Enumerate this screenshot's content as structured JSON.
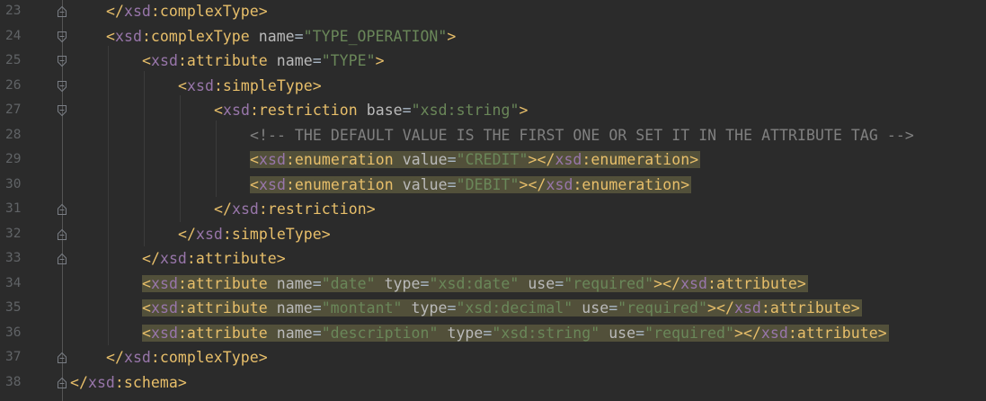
{
  "editor": {
    "lines": [
      {
        "number": "23",
        "fold": "fold-end",
        "segments": [
          {
            "t": "</",
            "c": "bracket"
          },
          {
            "t": "xsd",
            "c": "ns"
          },
          {
            "t": ":complexType",
            "c": "tag"
          },
          {
            "t": ">",
            "c": "bracket"
          }
        ]
      },
      {
        "number": "24",
        "fold": "fold-start",
        "segments": [
          {
            "t": "<",
            "c": "bracket"
          },
          {
            "t": "xsd",
            "c": "ns"
          },
          {
            "t": ":complexType ",
            "c": "tag"
          },
          {
            "t": "name",
            "c": "attr"
          },
          {
            "t": "=",
            "c": "eq"
          },
          {
            "t": "\"TYPE_OPERATION\"",
            "c": "str"
          },
          {
            "t": ">",
            "c": "bracket"
          }
        ]
      },
      {
        "number": "25",
        "fold": "fold-start",
        "segments": [
          {
            "t": "<",
            "c": "bracket"
          },
          {
            "t": "xsd",
            "c": "ns"
          },
          {
            "t": ":attribute ",
            "c": "tag"
          },
          {
            "t": "name",
            "c": "attr"
          },
          {
            "t": "=",
            "c": "eq"
          },
          {
            "t": "\"TYPE\"",
            "c": "str"
          },
          {
            "t": ">",
            "c": "bracket"
          }
        ]
      },
      {
        "number": "26",
        "fold": "fold-start",
        "segments": [
          {
            "t": "<",
            "c": "bracket"
          },
          {
            "t": "xsd",
            "c": "ns"
          },
          {
            "t": ":simpleType",
            "c": "tag"
          },
          {
            "t": ">",
            "c": "bracket"
          }
        ]
      },
      {
        "number": "27",
        "fold": "fold-start",
        "segments": [
          {
            "t": "<",
            "c": "bracket"
          },
          {
            "t": "xsd",
            "c": "ns"
          },
          {
            "t": ":restriction ",
            "c": "tag"
          },
          {
            "t": "base",
            "c": "attr"
          },
          {
            "t": "=",
            "c": "eq"
          },
          {
            "t": "\"xsd:string\"",
            "c": "str"
          },
          {
            "t": ">",
            "c": "bracket"
          }
        ]
      },
      {
        "number": "28",
        "fold": "none",
        "segments": [
          {
            "t": "<!-- THE DEFAULT VALUE IS THE FIRST ONE OR SET IT IN THE ATTRIBUTE TAG -->",
            "c": "comment"
          }
        ]
      },
      {
        "number": "29",
        "fold": "none",
        "highlight": true,
        "segments": [
          {
            "t": "<",
            "c": "bracket"
          },
          {
            "t": "xsd",
            "c": "ns"
          },
          {
            "t": ":enumeration ",
            "c": "tag"
          },
          {
            "t": "value",
            "c": "attr"
          },
          {
            "t": "=",
            "c": "eq"
          },
          {
            "t": "\"CREDIT\"",
            "c": "str"
          },
          {
            "t": "></",
            "c": "bracket"
          },
          {
            "t": "xsd",
            "c": "ns"
          },
          {
            "t": ":enumeration",
            "c": "tag"
          },
          {
            "t": ">",
            "c": "bracket"
          }
        ]
      },
      {
        "number": "30",
        "fold": "none",
        "highlight": true,
        "segments": [
          {
            "t": "<",
            "c": "bracket"
          },
          {
            "t": "xsd",
            "c": "ns"
          },
          {
            "t": ":enumeration ",
            "c": "tag"
          },
          {
            "t": "value",
            "c": "attr"
          },
          {
            "t": "=",
            "c": "eq"
          },
          {
            "t": "\"DEBIT\"",
            "c": "str"
          },
          {
            "t": "></",
            "c": "bracket"
          },
          {
            "t": "xsd",
            "c": "ns"
          },
          {
            "t": ":enumeration",
            "c": "tag"
          },
          {
            "t": ">",
            "c": "bracket"
          }
        ]
      },
      {
        "number": "31",
        "fold": "fold-end",
        "segments": [
          {
            "t": "</",
            "c": "bracket"
          },
          {
            "t": "xsd",
            "c": "ns"
          },
          {
            "t": ":restriction",
            "c": "tag"
          },
          {
            "t": ">",
            "c": "bracket"
          }
        ]
      },
      {
        "number": "32",
        "fold": "fold-end",
        "segments": [
          {
            "t": "</",
            "c": "bracket"
          },
          {
            "t": "xsd",
            "c": "ns"
          },
          {
            "t": ":simpleType",
            "c": "tag"
          },
          {
            "t": ">",
            "c": "bracket"
          }
        ]
      },
      {
        "number": "33",
        "fold": "fold-end",
        "segments": [
          {
            "t": "</",
            "c": "bracket"
          },
          {
            "t": "xsd",
            "c": "ns"
          },
          {
            "t": ":attribute",
            "c": "tag"
          },
          {
            "t": ">",
            "c": "bracket"
          }
        ]
      },
      {
        "number": "34",
        "fold": "none",
        "highlight": true,
        "segments": [
          {
            "t": "<",
            "c": "bracket"
          },
          {
            "t": "xsd",
            "c": "ns"
          },
          {
            "t": ":attribute ",
            "c": "tag"
          },
          {
            "t": "name",
            "c": "attr"
          },
          {
            "t": "=",
            "c": "eq"
          },
          {
            "t": "\"date\" ",
            "c": "str"
          },
          {
            "t": "type",
            "c": "attr"
          },
          {
            "t": "=",
            "c": "eq"
          },
          {
            "t": "\"xsd:date\" ",
            "c": "str"
          },
          {
            "t": "use",
            "c": "attr"
          },
          {
            "t": "=",
            "c": "eq"
          },
          {
            "t": "\"required\"",
            "c": "str"
          },
          {
            "t": "></",
            "c": "bracket"
          },
          {
            "t": "xsd",
            "c": "ns"
          },
          {
            "t": ":attribute",
            "c": "tag"
          },
          {
            "t": ">",
            "c": "bracket"
          }
        ]
      },
      {
        "number": "35",
        "fold": "none",
        "highlight": true,
        "segments": [
          {
            "t": "<",
            "c": "bracket"
          },
          {
            "t": "xsd",
            "c": "ns"
          },
          {
            "t": ":attribute ",
            "c": "tag"
          },
          {
            "t": "name",
            "c": "attr"
          },
          {
            "t": "=",
            "c": "eq"
          },
          {
            "t": "\"montant\" ",
            "c": "str"
          },
          {
            "t": "type",
            "c": "attr"
          },
          {
            "t": "=",
            "c": "eq"
          },
          {
            "t": "\"xsd:decimal\" ",
            "c": "str"
          },
          {
            "t": "use",
            "c": "attr"
          },
          {
            "t": "=",
            "c": "eq"
          },
          {
            "t": "\"required\"",
            "c": "str"
          },
          {
            "t": "></",
            "c": "bracket"
          },
          {
            "t": "xsd",
            "c": "ns"
          },
          {
            "t": ":attribute",
            "c": "tag"
          },
          {
            "t": ">",
            "c": "bracket"
          }
        ]
      },
      {
        "number": "36",
        "fold": "none",
        "highlight": true,
        "segments": [
          {
            "t": "<",
            "c": "bracket"
          },
          {
            "t": "xsd",
            "c": "ns"
          },
          {
            "t": ":attribute ",
            "c": "tag"
          },
          {
            "t": "name",
            "c": "attr"
          },
          {
            "t": "=",
            "c": "eq"
          },
          {
            "t": "\"description\" ",
            "c": "str"
          },
          {
            "t": "type",
            "c": "attr"
          },
          {
            "t": "=",
            "c": "eq"
          },
          {
            "t": "\"xsd:string\" ",
            "c": "str"
          },
          {
            "t": "use",
            "c": "attr"
          },
          {
            "t": "=",
            "c": "eq"
          },
          {
            "t": "\"required\"",
            "c": "str"
          },
          {
            "t": "></",
            "c": "bracket"
          },
          {
            "t": "xsd",
            "c": "ns"
          },
          {
            "t": ":attribute",
            "c": "tag"
          },
          {
            "t": ">",
            "c": "bracket"
          }
        ]
      },
      {
        "number": "37",
        "fold": "fold-end",
        "segments": [
          {
            "t": "</",
            "c": "bracket"
          },
          {
            "t": "xsd",
            "c": "ns"
          },
          {
            "t": ":complexType",
            "c": "tag"
          },
          {
            "t": ">",
            "c": "bracket"
          }
        ]
      },
      {
        "number": "38",
        "fold": "fold-end",
        "segments": [
          {
            "t": "</",
            "c": "bracket"
          },
          {
            "t": "xsd",
            "c": "ns"
          },
          {
            "t": ":schema",
            "c": "tag"
          },
          {
            "t": ">",
            "c": "bracket"
          }
        ]
      }
    ]
  },
  "colors": {
    "background": "#2b2b2b",
    "highlight": "#52503a",
    "bracket": "#e8bf6a",
    "namespace": "#9876aa",
    "attribute": "#bababa",
    "string": "#6a8759",
    "comment": "#808080",
    "line_number": "#606366"
  }
}
